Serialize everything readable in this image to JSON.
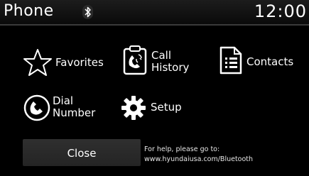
{
  "header": {
    "title": "Phone",
    "time": "12:00",
    "status_icon": "bluetooth-icon"
  },
  "menu": {
    "favorites": {
      "label": "Favorites",
      "icon": "star-icon"
    },
    "call_history": {
      "label_line1": "Call",
      "label_line2": "History",
      "icon": "call-history-icon"
    },
    "contacts": {
      "label": "Contacts",
      "icon": "contacts-icon"
    },
    "dial_number": {
      "label_line1": "Dial",
      "label_line2": "Number",
      "icon": "dial-phone-icon"
    },
    "setup": {
      "label": "Setup",
      "icon": "gear-icon"
    }
  },
  "footer": {
    "close_label": "Close",
    "help_line1": "For help, please go to:",
    "help_line2": "www.hyundaiusa.com/Bluetooth"
  },
  "colors": {
    "background": "#000000",
    "text": "#ffffff",
    "button": "#2a2a2a"
  }
}
